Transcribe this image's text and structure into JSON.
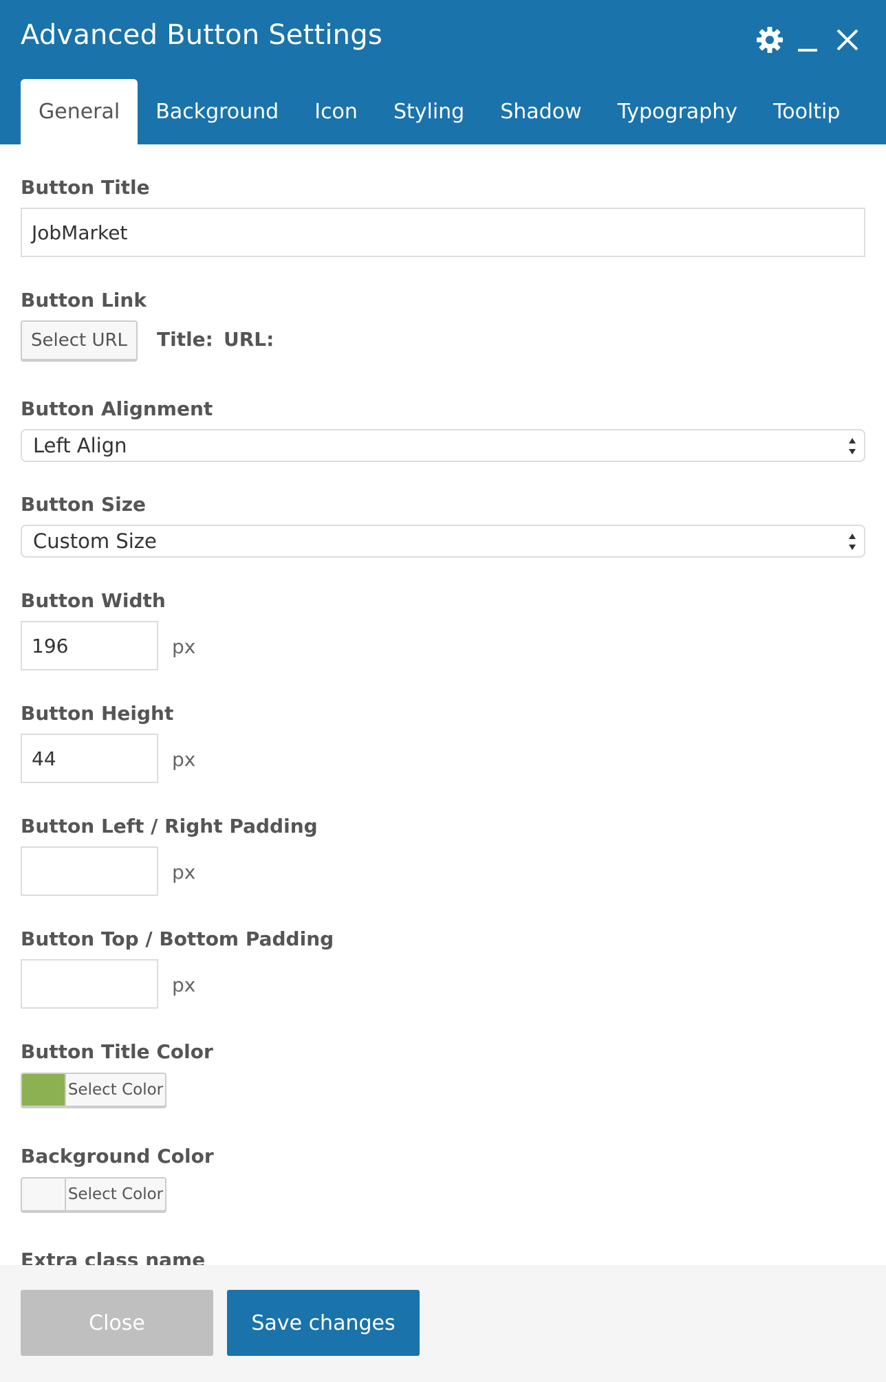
{
  "window": {
    "title": "Advanced Button Settings",
    "header_color": "#1a73aa",
    "icons": [
      "gear-icon",
      "minimize-icon",
      "close-icon"
    ]
  },
  "tabs": [
    {
      "label": "General",
      "active": true
    },
    {
      "label": "Background",
      "active": false
    },
    {
      "label": "Icon",
      "active": false
    },
    {
      "label": "Styling",
      "active": false
    },
    {
      "label": "Shadow",
      "active": false
    },
    {
      "label": "Typography",
      "active": false
    },
    {
      "label": "Tooltip",
      "active": false
    }
  ],
  "fields": {
    "button_title": {
      "label": "Button Title",
      "value": "JobMarket"
    },
    "button_link": {
      "label": "Button Link",
      "button": "Select URL",
      "title_label": "Title:",
      "url_label": "URL:"
    },
    "button_alignment": {
      "label": "Button Alignment",
      "selected": "Left Align"
    },
    "button_size": {
      "label": "Button Size",
      "selected": "Custom Size"
    },
    "button_width": {
      "label": "Button Width",
      "value": "196",
      "unit": "px"
    },
    "button_height": {
      "label": "Button Height",
      "value": "44",
      "unit": "px"
    },
    "lr_padding": {
      "label": "Button Left / Right Padding",
      "value": "",
      "unit": "px"
    },
    "tb_padding": {
      "label": "Button Top / Bottom Padding",
      "value": "",
      "unit": "px"
    },
    "title_color": {
      "label": "Button Title Color",
      "button": "Select Color",
      "swatch": "#8bb153"
    },
    "background_color": {
      "label": "Background Color",
      "button": "Select Color",
      "swatch": "#f7f7f7"
    },
    "extra_class": {
      "label": "Extra class name"
    }
  },
  "footer": {
    "close_label": "Close",
    "save_label": "Save changes"
  }
}
